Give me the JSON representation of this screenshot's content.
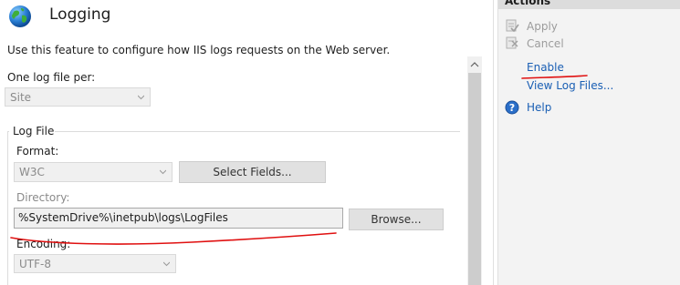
{
  "header": {
    "title": "Logging",
    "icon": "globe-icon"
  },
  "description": "Use this feature to configure how IIS logs requests on the Web server.",
  "one_log_file_per": {
    "label": "One log file per:",
    "value": "Site"
  },
  "log_file": {
    "group_label": "Log File",
    "format": {
      "label": "Format:",
      "value": "W3C",
      "button": "Select Fields..."
    },
    "directory": {
      "label": "Directory:",
      "value": "%SystemDrive%\\inetpub\\logs\\LogFiles",
      "button": "Browse..."
    },
    "encoding": {
      "label": "Encoding:",
      "value": "UTF-8"
    }
  },
  "actions": {
    "title": "Actions",
    "apply": "Apply",
    "cancel": "Cancel",
    "enable": "Enable",
    "view_log_files": "View Log Files...",
    "help": "Help"
  },
  "colors": {
    "annotation": "#e01010",
    "link": "#1a5fb4",
    "disabled": "#9c9c9c"
  }
}
